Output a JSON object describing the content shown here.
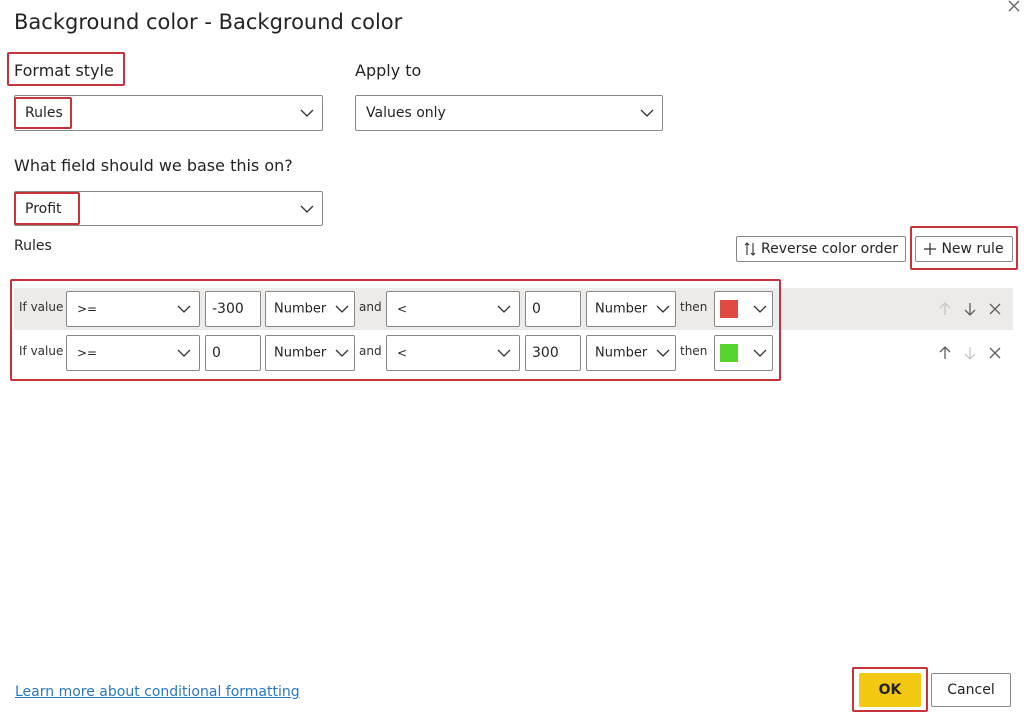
{
  "dialog": {
    "title": "Background color - Background color",
    "format_style": {
      "label": "Format style",
      "value": "Rules"
    },
    "apply_to": {
      "label": "Apply to",
      "value": "Values only"
    },
    "base_field": {
      "label": "What field should we base this on?",
      "value": "Profit"
    },
    "rules_label": "Rules",
    "reverse_button": "Reverse color order",
    "new_rule_button": "New rule",
    "rules": [
      {
        "if_label": "If value",
        "op1": ">=",
        "val1": "-300",
        "type1": "Number",
        "and_label": "and",
        "op2": "<",
        "val2": "0",
        "type2": "Number",
        "then_label": "then",
        "color": "#e04b41"
      },
      {
        "if_label": "If value",
        "op1": ">=",
        "val1": "0",
        "type1": "Number",
        "and_label": "and",
        "op2": "<",
        "val2": "300",
        "type2": "Number",
        "then_label": "then",
        "color": "#55d42e"
      }
    ],
    "learn_more": "Learn more about conditional formatting",
    "ok_button": "OK",
    "cancel_button": "Cancel",
    "colors": {
      "highlight": "#c8323a",
      "ok": "#f2c811",
      "link": "#2a78c5"
    }
  }
}
